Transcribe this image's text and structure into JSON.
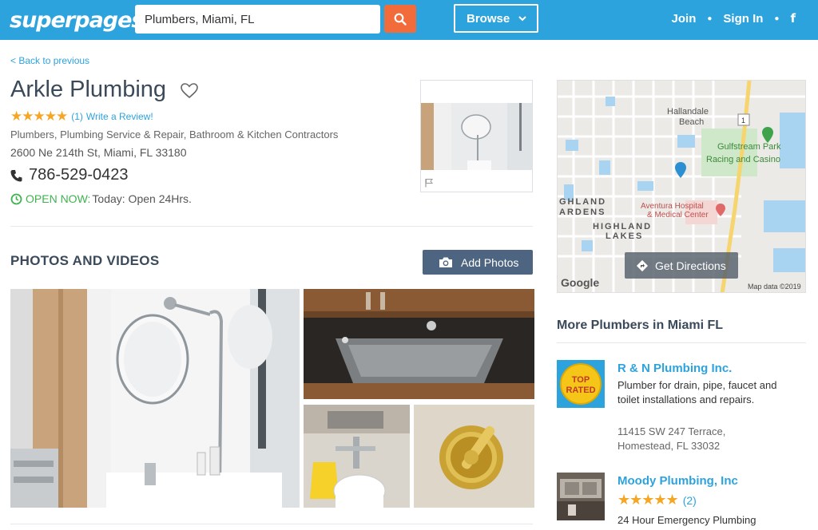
{
  "header": {
    "logo": "superpages",
    "logo_mark": "®",
    "search_value": "Plumbers, Miami, FL",
    "browse_label": "Browse",
    "nav": [
      "Join",
      "Sign In"
    ],
    "facebook": "f"
  },
  "business": {
    "back_label": "< Back to previous",
    "name": "Arkle Plumbing",
    "stars": "★★★★★",
    "rating_count": "(1)",
    "review_link": "Write a Review!",
    "categories": "Plumbers, Plumbing Service & Repair, Bathroom & Kitchen Contractors",
    "address": "2600 Ne 214th St, Miami, FL 33180",
    "phone": "786-529-0423",
    "open_label": "OPEN NOW:",
    "hours": "Today: Open 24Hrs."
  },
  "photos": {
    "title": "PHOTOS AND VIDEOS",
    "add_label": "Add Photos"
  },
  "map": {
    "labels": [
      "Hallandale",
      "Beach",
      "Gulfstream Park",
      "Racing and Casino",
      "GHLAND",
      "ARDENS",
      "HIGHLAND",
      "LAKES",
      "Aventura Hospital",
      "& Medical Center",
      "1"
    ],
    "directions_label": "Get Directions",
    "google_label": "Google",
    "map_data": "Map data ©2019"
  },
  "more": {
    "title": "More Plumbers in Miami FL",
    "listings": [
      {
        "name": "R & N Plumbing Inc.",
        "badge": [
          "TOP",
          "RATED"
        ],
        "description": "Plumber for drain, pipe, faucet and toilet installations and repairs.",
        "address_line1": "11415 SW 247 Terrace,",
        "address_line2": "Homestead, FL 33032"
      },
      {
        "name": "Moody Plumbing, Inc",
        "stars": "★★★★★",
        "rating_count": "(2)",
        "description": "24 Hour Emergency Plumbing"
      }
    ]
  },
  "colors": {
    "header": "#2da3dd",
    "search_button": "#f26b3b",
    "star": "#f5a623",
    "open_green": "#3fb34f",
    "link": "#2da3dd",
    "add_photos": "#4d6580"
  }
}
